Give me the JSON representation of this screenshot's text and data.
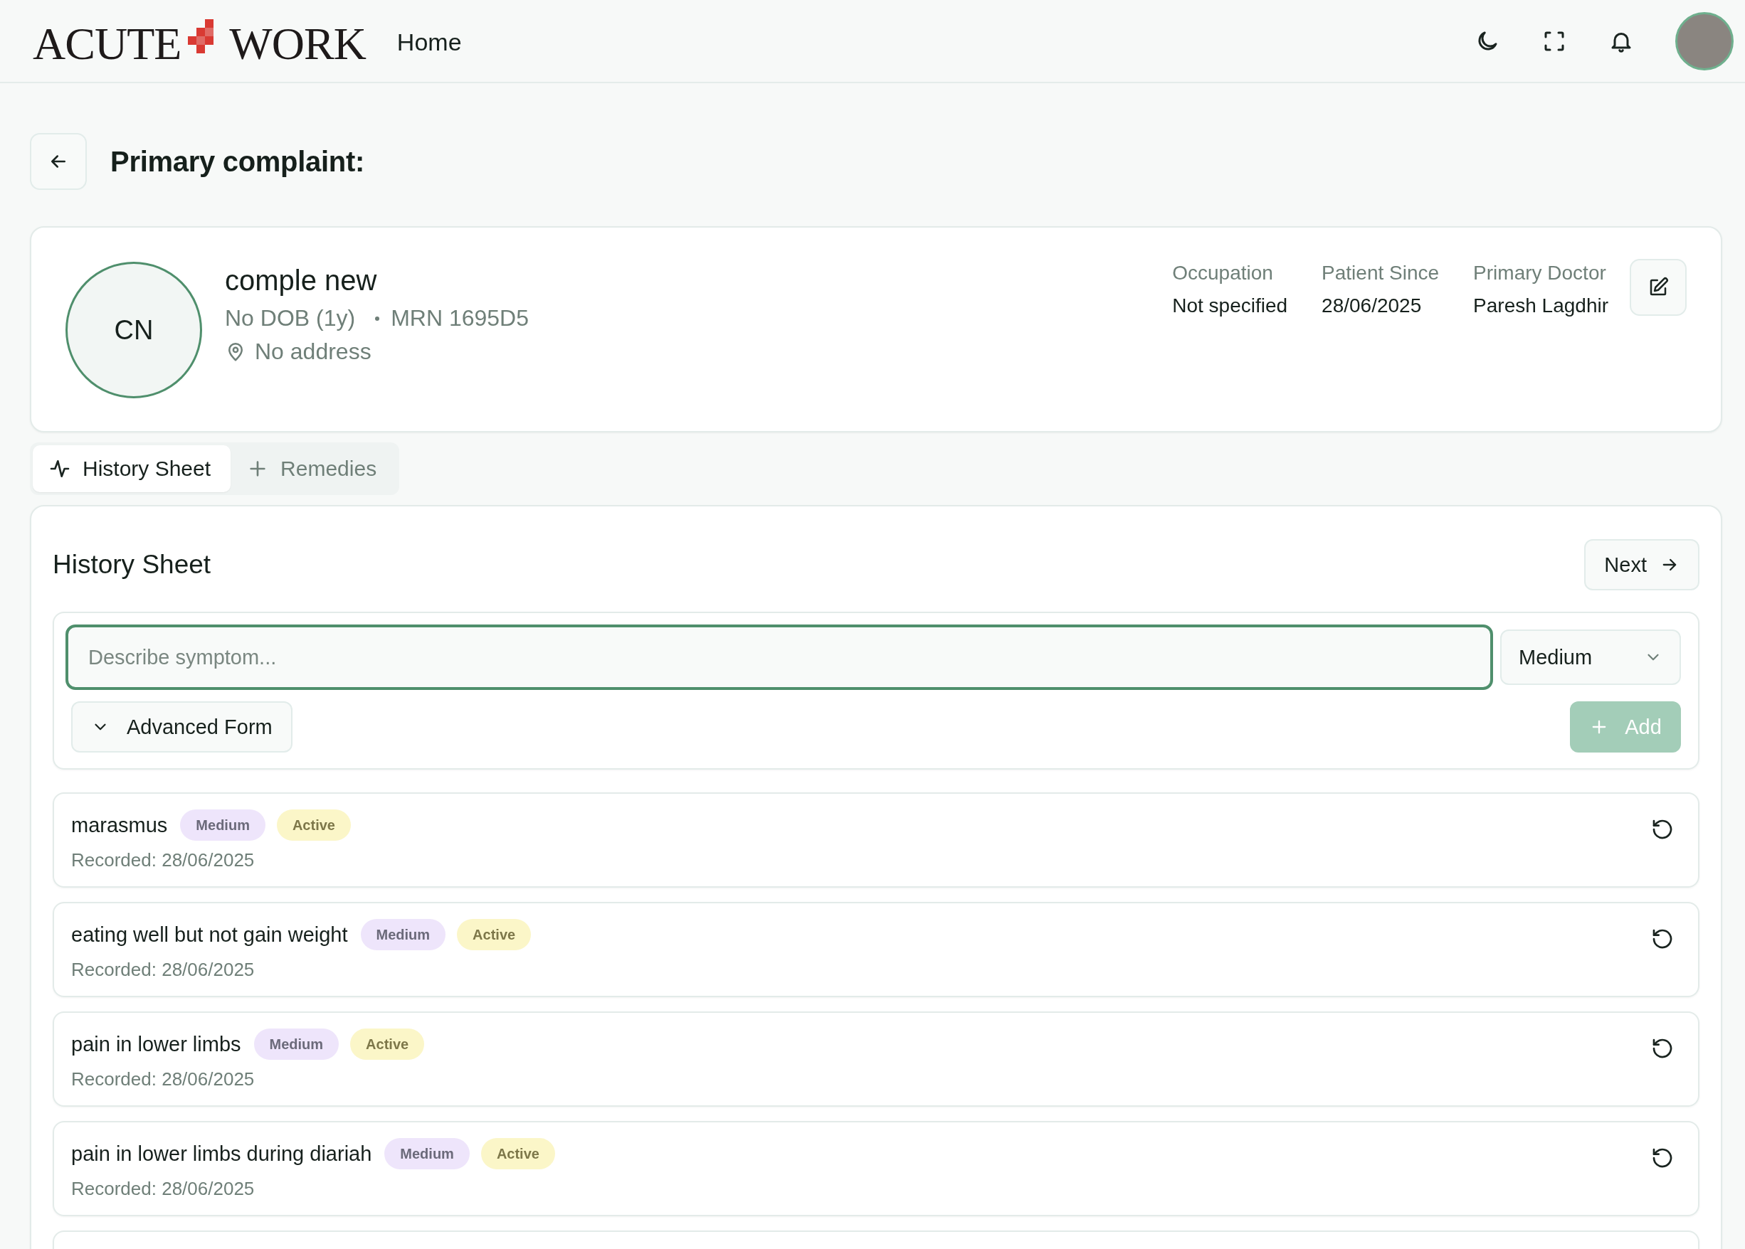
{
  "header": {
    "logo_left": "ACUTE",
    "logo_right": "WORK",
    "nav": "Home"
  },
  "page": {
    "title": "Primary complaint:"
  },
  "patient": {
    "initials": "CN",
    "name": "comple new",
    "dob": "No DOB (1y)",
    "mrn": "MRN 1695D5",
    "address": "No address",
    "details": [
      {
        "label": "Occupation",
        "value": "Not specified"
      },
      {
        "label": "Patient Since",
        "value": "28/06/2025"
      },
      {
        "label": "Primary Doctor",
        "value": "Paresh Lagdhir"
      }
    ]
  },
  "tabs": [
    {
      "label": "History Sheet",
      "selected": true
    },
    {
      "label": "Remedies",
      "selected": false
    }
  ],
  "history": {
    "title": "History Sheet",
    "next_button": "Next",
    "symptom_input": {
      "placeholder": "Describe symptom..."
    },
    "severity_select": {
      "value": "Medium"
    },
    "advanced_form": "Advanced Form",
    "add_button": {
      "label": "Add",
      "disabled": true
    },
    "symptoms": [
      {
        "name": "marasmus",
        "severity": "Medium",
        "status": "Active",
        "recorded": "Recorded: 28/06/2025"
      },
      {
        "name": "eating well but not gain weight",
        "severity": "Medium",
        "status": "Active",
        "recorded": "Recorded: 28/06/2025"
      },
      {
        "name": "pain in lower limbs",
        "severity": "Medium",
        "status": "Active",
        "recorded": "Recorded: 28/06/2025"
      },
      {
        "name": "pain in lower limbs during diariah",
        "severity": "Medium",
        "status": "Active",
        "recorded": "Recorded: 28/06/2025"
      }
    ]
  }
}
